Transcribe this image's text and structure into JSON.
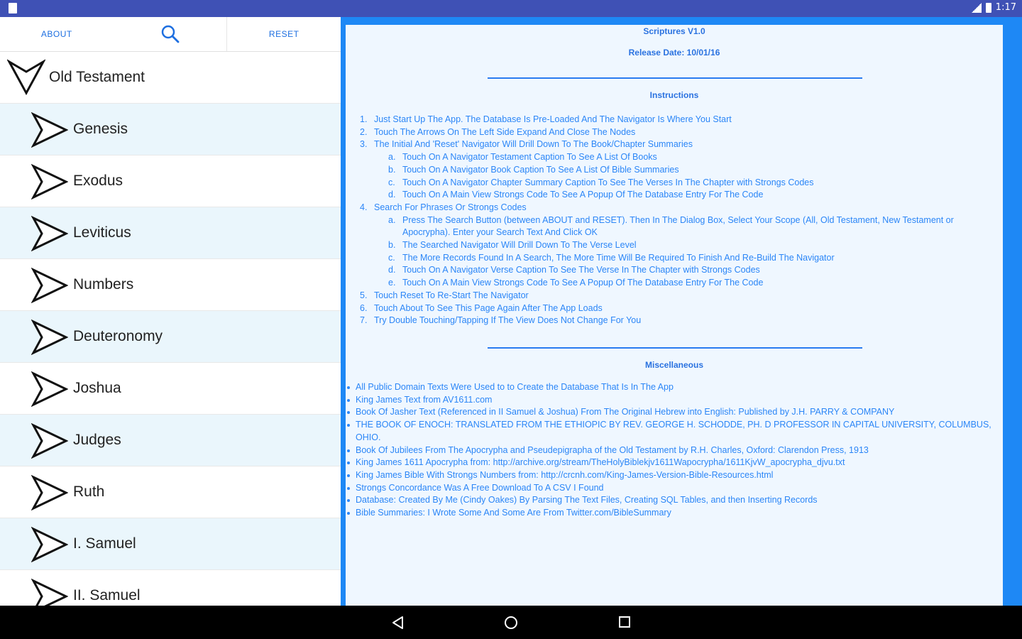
{
  "status_bar": {
    "time": "1:17"
  },
  "toolbar": {
    "about_label": "ABOUT",
    "reset_label": "RESET"
  },
  "tree": {
    "root_label": "Old Testament",
    "books": [
      "Genesis",
      "Exodus",
      "Leviticus",
      "Numbers",
      "Deuteronomy",
      "Joshua",
      "Judges",
      "Ruth",
      "I. Samuel",
      "II. Samuel"
    ]
  },
  "content": {
    "title": "Scriptures V1.0",
    "release": "Release Date: 10/01/16",
    "instructions_heading": "Instructions",
    "instructions": [
      {
        "n": "1.",
        "text": "Just Start Up The App. The Database Is Pre-Loaded And The Navigator Is Where You Start"
      },
      {
        "n": "2.",
        "text": "Touch The Arrows On The Left Side Expand And Close The Nodes"
      },
      {
        "n": "3.",
        "text": "The Initial And 'Reset' Navigator Will Drill Down To The Book/Chapter Summaries",
        "sub": [
          {
            "n": "a.",
            "text": "Touch On A Navigator Testament Caption To See A List Of Books"
          },
          {
            "n": "b.",
            "text": "Touch On A Navigator Book Caption To See A List Of Bible Summaries"
          },
          {
            "n": "c.",
            "text": "Touch On A Navigator Chapter Summary Caption To See The Verses In The Chapter with Strongs Codes"
          },
          {
            "n": "d.",
            "text": "Touch On A Main View Strongs Code To See A Popup Of The Database Entry For The Code"
          }
        ]
      },
      {
        "n": "4.",
        "text": "Search For Phrases Or Strongs Codes",
        "sub": [
          {
            "n": "a.",
            "text": "Press The Search Button (between ABOUT and RESET). Then In The Dialog Box, Select Your Scope (All, Old Testament, New Testament or Apocrypha). Enter your Search Text And Click OK"
          },
          {
            "n": "b.",
            "text": "The Searched Navigator Will Drill Down To The Verse Level"
          },
          {
            "n": "c.",
            "text": "The More Records Found In A Search, The More Time Will Be Required To Finish And Re-Build The Navigator"
          },
          {
            "n": "d.",
            "text": "Touch On A Navigator Verse Caption To See The Verse In The Chapter with Strongs Codes"
          },
          {
            "n": "e.",
            "text": "Touch On A Main View Strongs Code To See A Popup Of The Database Entry For The Code"
          }
        ]
      },
      {
        "n": "5.",
        "text": "Touch Reset To Re-Start The Navigator"
      },
      {
        "n": "6.",
        "text": "Touch About To See This Page Again After The App Loads"
      },
      {
        "n": "7.",
        "text": "Try Double Touching/Tapping If The View Does Not Change For You"
      }
    ],
    "misc_heading": "Miscellaneous",
    "misc": [
      "All Public Domain Texts Were Used to to Create the Database That Is In The App",
      "King James Text from AV1611.com",
      "Book Of Jasher Text (Referenced in II Samuel & Joshua) From The Original Hebrew into English: Published by J.H. PARRY & COMPANY",
      "THE BOOK OF ENOCH: TRANSLATED FROM THE ETHIOPIC BY REV. GEORGE H. SCHODDE, PH. D PROFESSOR IN CAPITAL UNIVERSITY, COLUMBUS, OHIO.",
      "Book Of Jubilees From The Apocrypha and Pseudepigrapha of the Old Testament by R.H. Charles, Oxford: Clarendon Press, 1913",
      "King James 1611 Apocrypha from: http://archive.org/stream/TheHolyBiblekjv1611Wapocrypha/1611KjvW_apocrypha_djvu.txt",
      "King James Bible With Strongs Numbers from: http://crcnh.com/King-James-Version-Bible-Resources.html",
      "Strongs Concordance Was A Free Download To A CSV I Found",
      "Database: Created By Me (Cindy Oakes) By Parsing The Text Files, Creating SQL Tables, and then Inserting Records",
      "Bible Summaries: I Wrote Some And Some Are From Twitter.com/BibleSummary"
    ]
  },
  "colors": {
    "status_bar": "#3f51b5",
    "accent": "#1e88f5",
    "content_bg": "#eff7ff",
    "alt_row": "#eaf6fc"
  }
}
